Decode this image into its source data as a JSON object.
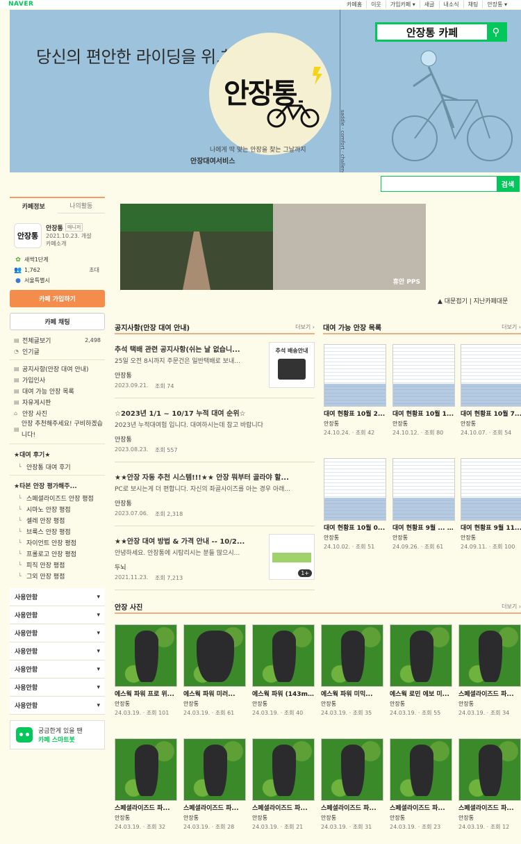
{
  "topbar": {
    "logo": "NAVER",
    "menu": [
      "카페홈",
      "이웃",
      "가입카페 ▾",
      "새글",
      "내소식",
      "채팅",
      "안장통 ▾"
    ]
  },
  "banner": {
    "slogan": "당신의 편안한 라이딩을 위.하.여",
    "logo_text": "안장통",
    "sub1": "나에게 딱 맞는 안장을 찾는 그날까지",
    "sub2": "안장대여서비스",
    "vertical_text": "saddle · comfort · challenge",
    "search_text": "안장통 카페"
  },
  "search": {
    "button": "검색",
    "placeholder": ""
  },
  "sidebar": {
    "tabs": [
      "카페정보",
      "나의활동"
    ],
    "cafe": {
      "logo_text": "안장통",
      "name": "안장통",
      "manager_badge": "매니저",
      "date": "2021.10.23. 개설",
      "intro": "카페소개"
    },
    "level": "새싹1단계",
    "members": "1,762",
    "invite": "초대",
    "region": "서울특별시",
    "join_button": "카페 가입하기",
    "chat_button": "카페 채팅",
    "all_posts": {
      "label": "전체글보기",
      "count": "2,498"
    },
    "popular": "인기글",
    "menus": [
      "공지사항(안장 대여 안내)",
      "가입인사",
      "대여 가능 안장 목록",
      "자유게시판",
      "안장 사진"
    ],
    "recommend": "안장 추천해주세요! 구비하겠습니다!",
    "group1": {
      "title": "★대여 후기★",
      "items": [
        "안장통 대여 후기"
      ]
    },
    "group2": {
      "title": "★타본 안장 평가해주...",
      "items": [
        "스페셜라이즈드 안장 평점",
        "시마노 안장 평점",
        "셀레 안장 평점",
        "브룩스 안장 평점",
        "자이언트 안장 평점",
        "프롤로고 안장 평점",
        "피직 안장 평점",
        "그외 안장 평점"
      ]
    },
    "unused": [
      "사용안함",
      "사용안함",
      "사용안함",
      "사용안함",
      "사용안함",
      "사용안함",
      "사용안함"
    ],
    "chatbot": {
      "line1": "궁금한게 있을 땐",
      "line2": "카페 스마트봇"
    }
  },
  "main": {
    "banner_caption": "휴안 PPS",
    "nav": "▲ 대문접기 | 지난카페대문",
    "notice": {
      "title": "공지사항(안장 대여 안내)",
      "more": "더보기 ›",
      "posts": [
        {
          "title": "추석 택배 관련 공지사항(쉬는 날 없습니...",
          "excerpt": "25일 오전 8시까지 주문건은 일반택배로 보내...",
          "author": "안장통",
          "date": "2023.09.21.",
          "views": "조회 74",
          "thumb": "추석 배송안내"
        },
        {
          "title": "☆2023년 1/1 ~ 10/17 누적 대여 순위☆",
          "excerpt": "2023년 누적대여험 입니다. 대여하시는데 참고 바랍니다",
          "author": "안장통",
          "date": "2023.08.23.",
          "views": "조회 557"
        },
        {
          "title": "★★안장 자동 추천 시스템!!!★★ 안장 뭐부터 골라야 할...",
          "excerpt": "PC로 보시는게 더 편합니다. 자신의 좌골사이즈를 아는 경우 아래...",
          "author": "안장통",
          "date": "2023.07.06.",
          "views": "조회 2,318"
        },
        {
          "title": "★★안장 대여 방법 & 가격 안내 -- 10/2...",
          "excerpt": "안녕하세요. 안장통에 시탐리시는 분들 많으시...",
          "author": "두뇌",
          "date": "2021.11.23.",
          "views": "조회 7,213",
          "badge": "1+"
        }
      ]
    },
    "rental": {
      "title": "대여 가능 안장 목록",
      "more": "더보기 ›",
      "cards": [
        {
          "title": "대여 현황표 10월 2...",
          "author": "안장통",
          "date": "24.10.24.",
          "views": "조회 42"
        },
        {
          "title": "대여 현황표 10월 1...",
          "author": "안장통",
          "date": "24.10.12.",
          "views": "조회 80"
        },
        {
          "title": "대여 현황표 10월 7...",
          "author": "안장통",
          "date": "24.10.07.",
          "views": "조회 54"
        },
        {
          "title": "대여 현황표 10월 0...",
          "author": "안장통",
          "date": "24.10.02.",
          "views": "조회 51"
        },
        {
          "title": "대여 현황표 9월 ...",
          "badge": "[1]",
          "author": "안장통",
          "date": "24.09.26.",
          "views": "조회 61"
        },
        {
          "title": "대여 현황표 9월 11...",
          "author": "안장통",
          "date": "24.09.11.",
          "views": "조회 100"
        }
      ]
    },
    "photos": {
      "title": "안장 사진",
      "more": "더보기 ›",
      "cards": [
        {
          "title": "에스웍 파워 프로 위...",
          "author": "안장통",
          "date": "24.03.19.",
          "views": "조회 101"
        },
        {
          "title": "에스웍 파워 미러...",
          "author": "안장통",
          "date": "24.03.19.",
          "views": "조회 61"
        },
        {
          "title": "에스웍 파워 (143mm)",
          "author": "안장통",
          "date": "24.03.19.",
          "views": "조회 40"
        },
        {
          "title": "에스웍 파워 미믹...",
          "author": "안장통",
          "date": "24.03.19.",
          "views": "조회 35"
        },
        {
          "title": "에스웍 로민 에보 미...",
          "author": "안장통",
          "date": "24.03.19.",
          "views": "조회 55"
        },
        {
          "title": "스페셜라이즈드 파...",
          "author": "안장통",
          "date": "24.03.19.",
          "views": "조회 34"
        },
        {
          "title": "스페셜라이즈드 파...",
          "author": "안장통",
          "date": "24.03.19.",
          "views": "조회 32"
        },
        {
          "title": "스페셜라이즈드 파...",
          "author": "안장통",
          "date": "24.03.19.",
          "views": "조회 28"
        },
        {
          "title": "스페셜라이즈드 파...",
          "author": "안장통",
          "date": "24.03.19.",
          "views": "조회 21"
        },
        {
          "title": "스페셜라이즈드 파...",
          "author": "안장통",
          "date": "24.03.19.",
          "views": "조회 31"
        },
        {
          "title": "스페셜라이즈드 파...",
          "author": "안장통",
          "date": "24.03.19.",
          "views": "조회 23"
        },
        {
          "title": "스페셜라이즈드 파...",
          "author": "안장통",
          "date": "24.03.19.",
          "views": "조회 12"
        }
      ]
    }
  }
}
